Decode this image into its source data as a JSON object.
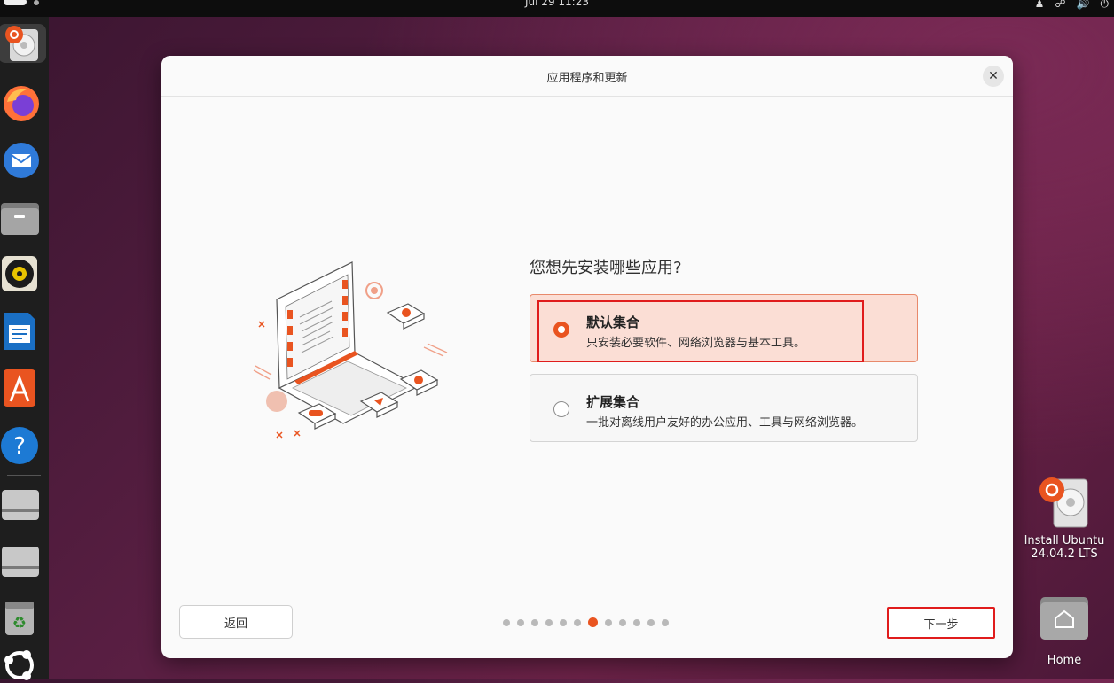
{
  "topbar": {
    "clock": "Jul 29  11:23",
    "tray_icons": [
      "accessibility-icon",
      "network-icon",
      "volume-icon",
      "power-icon"
    ]
  },
  "dock": {
    "items": [
      {
        "name": "ubuntu-installer-icon",
        "color": "#e95420",
        "active": true
      },
      {
        "name": "firefox-icon",
        "color": "#ff7139"
      },
      {
        "name": "thunderbird-icon",
        "color": "#2f7ad9"
      },
      {
        "name": "files-icon",
        "color": "#8a8a8a"
      },
      {
        "name": "rhythmbox-icon",
        "color": "#e8c300"
      },
      {
        "name": "libreoffice-writer-icon",
        "color": "#1a6fc4"
      },
      {
        "name": "app-center-icon",
        "color": "#e95420"
      },
      {
        "name": "help-icon",
        "color": "#1d7ad4"
      },
      {
        "name": "drive-icon",
        "color": "#bdbdbd"
      },
      {
        "name": "drive-icon",
        "color": "#bdbdbd"
      },
      {
        "name": "trash-icon",
        "color": "#9a9a9a"
      },
      {
        "name": "show-apps-icon",
        "color": "#ffffff"
      }
    ]
  },
  "dialog": {
    "title": "应用程序和更新",
    "close_glyph": "✕",
    "question": "您想先安装哪些应用?",
    "options": [
      {
        "title": "默认集合",
        "desc": "只安装必要软件、网络浏览器与基本工具。",
        "selected": true
      },
      {
        "title": "扩展集合",
        "desc": "一批对离线用户友好的办公应用、工具与网络浏览器。",
        "selected": false
      }
    ],
    "back_label": "返回",
    "next_label": "下一步",
    "progress": {
      "total": 12,
      "current": 7
    }
  },
  "desktop": {
    "install_label_1": "Install Ubuntu",
    "install_label_2": "24.04.2 LTS",
    "home_label": "Home"
  },
  "colors": {
    "accent": "#e95420",
    "highlight": "#e01c1c"
  }
}
